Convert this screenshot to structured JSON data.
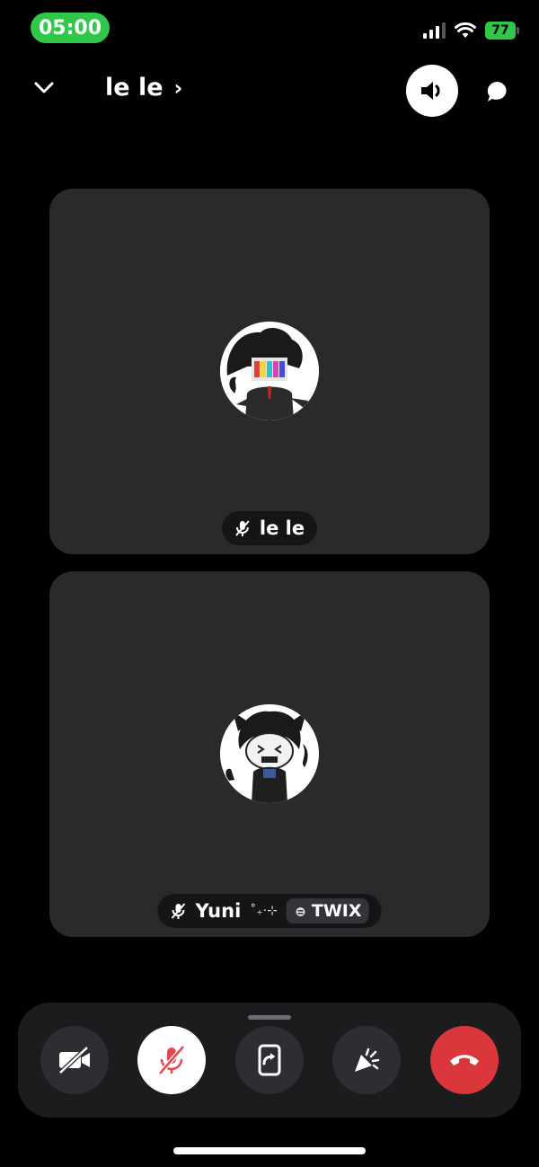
{
  "status_bar": {
    "time": "05:00",
    "battery": "77"
  },
  "header": {
    "title": "le le",
    "title_arrow": "›"
  },
  "participants": [
    {
      "name": "le le"
    },
    {
      "name": "Yuni",
      "decoration": "˚₊·⊹",
      "tag": "TWIX"
    }
  ],
  "controls": [
    {
      "name": "camera-off"
    },
    {
      "name": "microphone-muted"
    },
    {
      "name": "screen-share"
    },
    {
      "name": "soundboard"
    },
    {
      "name": "leave-call",
      "color": "#da373c"
    }
  ],
  "colors": {
    "time_pill": "#30c84b",
    "tile_bg": "#2a2a2c",
    "end_call": "#da373c",
    "mute_icon": "#e0494e"
  }
}
